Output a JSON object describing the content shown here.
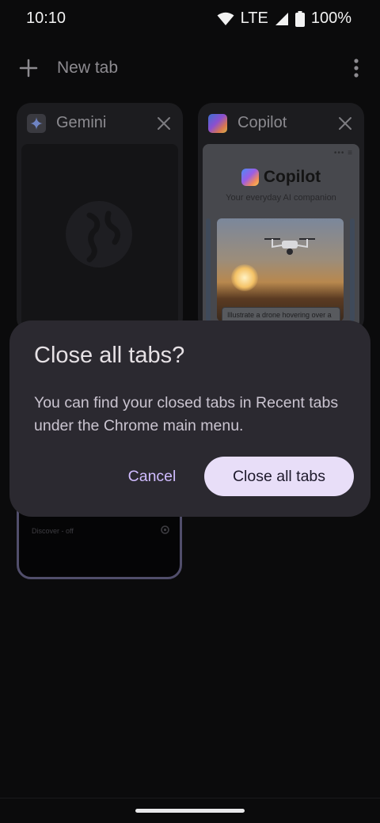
{
  "status_bar": {
    "time": "10:10",
    "network": "LTE",
    "battery": "100%",
    "icons": [
      "wifi-icon",
      "signal-icon",
      "battery-icon"
    ]
  },
  "toolbar": {
    "new_tab_label": "New tab",
    "icons": [
      "plus-icon",
      "more-vert-icon"
    ]
  },
  "tabs": [
    {
      "title": "Gemini",
      "favicon": "gemini-sparkle-icon"
    },
    {
      "title": "Copilot",
      "favicon": "copilot-logo-icon",
      "thumbnail": {
        "heading": "Copilot",
        "subtitle": "Your everyday AI companion",
        "caption": "Illustrate a drone hovering over a"
      }
    },
    {
      "title": "",
      "thumbnail": {
        "footer_text": "Discover - off"
      }
    }
  ],
  "dialog": {
    "title": "Close all tabs?",
    "body": "You can find your closed tabs in Recent tabs under the Chrome main menu.",
    "cancel_label": "Cancel",
    "confirm_label": "Close all tabs"
  },
  "colors": {
    "background": "#0b0b0c",
    "dialog_surface": "#2b2930",
    "accent_text": "#d0bcff",
    "primary_button": "#e8def8"
  }
}
